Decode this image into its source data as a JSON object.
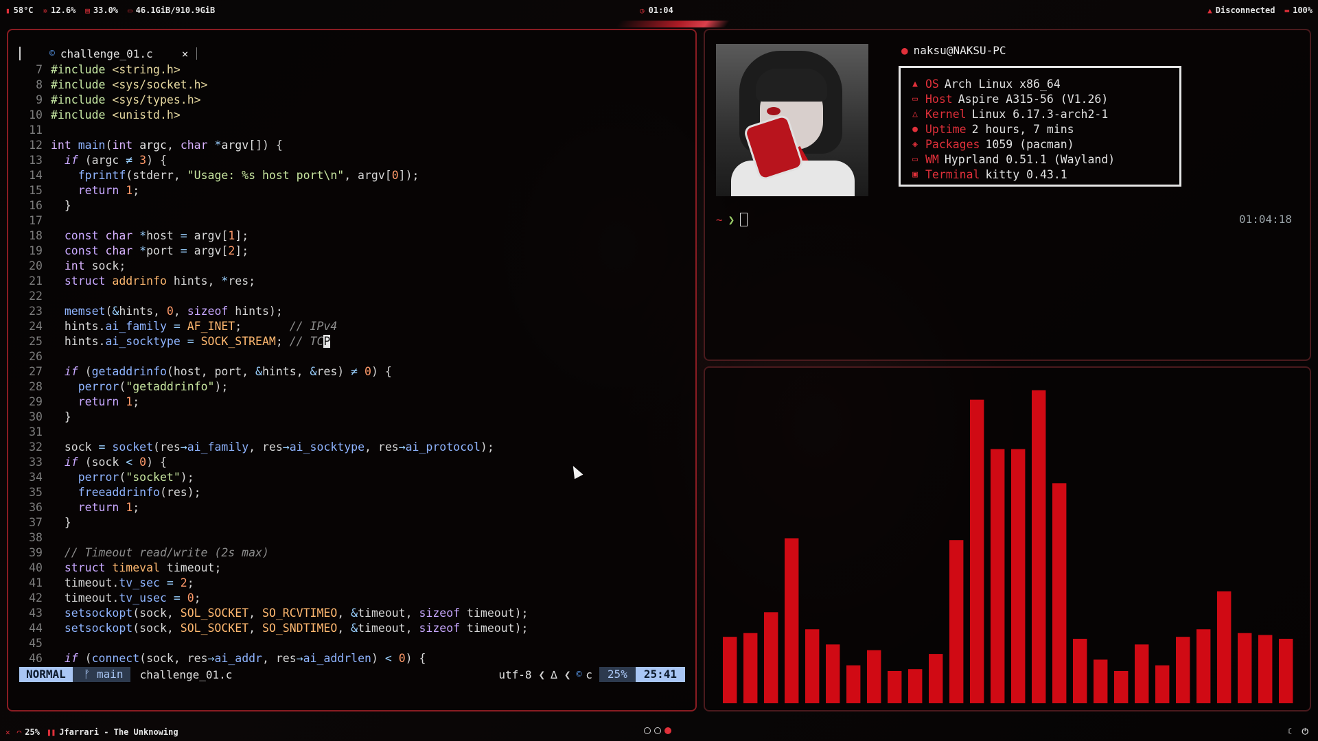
{
  "topbar": {
    "temp": "58°C",
    "cpu": "12.6%",
    "mem": "33.0%",
    "disk": "46.1GiB/910.9GiB",
    "time": "01:04",
    "network": "Disconnected",
    "battery": "100%"
  },
  "editor": {
    "tab_title": "challenge_01.c",
    "tab_close": "×",
    "lines": [
      {
        "n": "7",
        "code": "<span class='pp'>#include</span> <span class='inc'>&lt;string.h&gt;</span>"
      },
      {
        "n": "8",
        "code": "<span class='pp'>#include</span> <span class='inc'>&lt;sys/socket.h&gt;</span>"
      },
      {
        "n": "9",
        "code": "<span class='pp'>#include</span> <span class='inc'>&lt;sys/types.h&gt;</span>"
      },
      {
        "n": "10",
        "code": "<span class='pp'>#include</span> <span class='inc'>&lt;unistd.h&gt;</span>"
      },
      {
        "n": "11",
        "code": ""
      },
      {
        "n": "12",
        "code": "<span class='ty'>int</span> <span class='fn'>main</span>(<span class='ty'>int</span> <span class='id'>argc</span>, <span class='ty'>char</span> <span class='op'>*</span><span class='id'>argv</span>[]) {"
      },
      {
        "n": "13",
        "code": "  <span class='k'><i>if</i></span> (argc <span class='op'>≠</span> <span class='nu'>3</span>) {"
      },
      {
        "n": "14",
        "code": "    <span class='fn'>fprintf</span>(stderr, <span class='st'>\"Usage: %s host port\\n\"</span>, argv[<span class='nu'>0</span>]);"
      },
      {
        "n": "15",
        "code": "    <span class='k'>return</span> <span class='nu'>1</span>;"
      },
      {
        "n": "16",
        "code": "  }"
      },
      {
        "n": "17",
        "code": ""
      },
      {
        "n": "18",
        "code": "  <span class='k'>const</span> <span class='ty'>char</span> <span class='op'>*</span>host <span class='op'>=</span> argv[<span class='nu'>1</span>];"
      },
      {
        "n": "19",
        "code": "  <span class='k'>const</span> <span class='ty'>char</span> <span class='op'>*</span>port <span class='op'>=</span> argv[<span class='nu'>2</span>];"
      },
      {
        "n": "20",
        "code": "  <span class='ty'>int</span> sock;"
      },
      {
        "n": "21",
        "code": "  <span class='k'>struct</span> <span class='ma'>addrinfo</span> hints, <span class='op'>*</span>res;"
      },
      {
        "n": "22",
        "code": ""
      },
      {
        "n": "23",
        "code": "  <span class='fn'>memset</span>(<span class='op'>&amp;</span>hints, <span class='nu'>0</span>, <span class='k'>sizeof</span> hints);"
      },
      {
        "n": "24",
        "code": "  hints.<span class='fn'>ai_family</span> <span class='op'>=</span> <span class='ma'>AF_INET</span>;       <span class='cm'>// IPv4</span>"
      },
      {
        "n": "25",
        "code": "  hints.<span class='fn'>ai_socktype</span> <span class='op'>=</span> <span class='ma'>SOCK_STREAM</span>; <span class='cm'>// TC</span><span class='cur'>P</span>"
      },
      {
        "n": "26",
        "code": ""
      },
      {
        "n": "27",
        "code": "  <span class='k'><i>if</i></span> (<span class='fn'>getaddrinfo</span>(host, port, <span class='op'>&amp;</span>hints, <span class='op'>&amp;</span>res) <span class='op'>≠</span> <span class='nu'>0</span>) {"
      },
      {
        "n": "28",
        "code": "    <span class='fn'>perror</span>(<span class='st'>\"getaddrinfo\"</span>);"
      },
      {
        "n": "29",
        "code": "    <span class='k'>return</span> <span class='nu'>1</span>;"
      },
      {
        "n": "30",
        "code": "  }"
      },
      {
        "n": "31",
        "code": ""
      },
      {
        "n": "32",
        "code": "  sock <span class='op'>=</span> <span class='fn'>socket</span>(res<span class='op'>→</span><span class='fn'>ai_family</span>, res<span class='op'>→</span><span class='fn'>ai_socktype</span>, res<span class='op'>→</span><span class='fn'>ai_protocol</span>);"
      },
      {
        "n": "33",
        "code": "  <span class='k'><i>if</i></span> (sock <span class='op'>&lt;</span> <span class='nu'>0</span>) {"
      },
      {
        "n": "34",
        "code": "    <span class='fn'>perror</span>(<span class='st'>\"socket\"</span>);"
      },
      {
        "n": "35",
        "code": "    <span class='fn'>freeaddrinfo</span>(res);"
      },
      {
        "n": "36",
        "code": "    <span class='k'>return</span> <span class='nu'>1</span>;"
      },
      {
        "n": "37",
        "code": "  }"
      },
      {
        "n": "38",
        "code": ""
      },
      {
        "n": "39",
        "code": "  <span class='cm'>// Timeout read/write (2s max)</span>"
      },
      {
        "n": "40",
        "code": "  <span class='k'>struct</span> <span class='ma'>timeval</span> timeout;"
      },
      {
        "n": "41",
        "code": "  timeout.<span class='fn'>tv_sec</span> <span class='op'>=</span> <span class='nu'>2</span>;"
      },
      {
        "n": "42",
        "code": "  timeout.<span class='fn'>tv_usec</span> <span class='op'>=</span> <span class='nu'>0</span>;"
      },
      {
        "n": "43",
        "code": "  <span class='fn'>setsockopt</span>(sock, <span class='ma'>SOL_SOCKET</span>, <span class='ma'>SO_RCVTIMEO</span>, <span class='op'>&amp;</span>timeout, <span class='k'>sizeof</span> timeout);"
      },
      {
        "n": "44",
        "code": "  <span class='fn'>setsockopt</span>(sock, <span class='ma'>SOL_SOCKET</span>, <span class='ma'>SO_SNDTIMEO</span>, <span class='op'>&amp;</span>timeout, <span class='k'>sizeof</span> timeout);"
      },
      {
        "n": "45",
        "code": ""
      },
      {
        "n": "46",
        "code": "  <span class='k'><i>if</i></span> (<span class='fn'>connect</span>(sock, res<span class='op'>→</span><span class='fn'>ai_addr</span>, res<span class='op'>→</span><span class='fn'>ai_addrlen</span>) <span class='op'>&lt;</span> <span class='nu'>0</span>) {"
      }
    ],
    "status": {
      "mode": "NORMAL",
      "branch": "main",
      "file": "challenge_01.c",
      "encoding": "utf-8",
      "filetype": "c",
      "percent": "25%",
      "position": "25:41"
    }
  },
  "fetch": {
    "userhost": "naksu@NAKSU-PC",
    "rows": [
      {
        "icon": "arch-icon",
        "glyph": "▲",
        "key": "OS",
        "value": "Arch Linux x86_64"
      },
      {
        "icon": "laptop-icon",
        "glyph": "▭",
        "key": "Host",
        "value": "Aspire A315-56 (V1.26)"
      },
      {
        "icon": "kernel-icon",
        "glyph": "△",
        "key": "Kernel",
        "value": "Linux 6.17.3-arch2-1"
      },
      {
        "icon": "clock-icon",
        "glyph": "●",
        "key": "Uptime",
        "value": "2 hours, 7 mins"
      },
      {
        "icon": "package-icon",
        "glyph": "◈",
        "key": "Packages",
        "value": "1059 (pacman)"
      },
      {
        "icon": "window-icon",
        "glyph": "▭",
        "key": "WM",
        "value": "Hyprland 0.51.1 (Wayland)"
      },
      {
        "icon": "terminal-icon",
        "glyph": "▣",
        "key": "Terminal",
        "value": "kitty 0.43.1"
      }
    ],
    "prompt_tilde": "~",
    "prompt_chevron": "❯",
    "clock": "01:04:18"
  },
  "cava": {
    "color": "#d00a14",
    "levels": [
      0.35,
      0.37,
      0.48,
      0.87,
      0.39,
      0.31,
      0.2,
      0.28,
      0.17,
      0.18,
      0.26,
      0.86,
      1.6,
      1.34,
      1.34,
      1.65,
      1.16,
      0.34,
      0.23,
      0.17,
      0.31,
      0.2,
      0.35,
      0.39,
      0.59,
      0.37,
      0.36,
      0.34
    ]
  },
  "bottombar": {
    "volume": "25%",
    "media": "Jfarrari - The Unknowing"
  },
  "colors": {
    "accent": "#e0303a",
    "border": "#8a1c22",
    "mode_bg": "#a9c6f4"
  }
}
